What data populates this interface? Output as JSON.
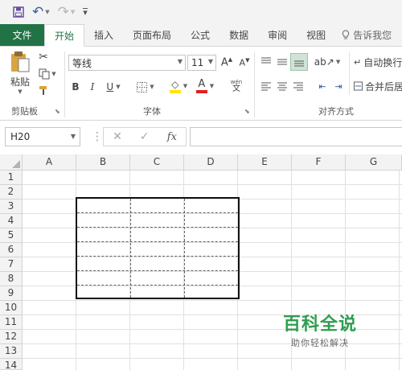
{
  "qat": {
    "save_glyph": "💾",
    "undo_glyph": "↶",
    "redo_glyph": "↷",
    "customize_glyph": "▾"
  },
  "tabs": {
    "file": "文件",
    "items": [
      "开始",
      "插入",
      "页面布局",
      "公式",
      "数据",
      "审阅",
      "视图"
    ],
    "tell_me": "告诉我您"
  },
  "ribbon": {
    "clipboard": {
      "paste": "粘贴",
      "label": "剪贴板"
    },
    "font": {
      "name": "等线",
      "size": "11",
      "bold": "B",
      "italic": "I",
      "underline": "U",
      "font_color_letter": "A",
      "label": "字体",
      "phonetic": "wén"
    },
    "alignment": {
      "wrap_text": "自动换行",
      "merge_center": "合并后居",
      "label": "对齐方式"
    }
  },
  "formula_bar": {
    "name_box": "H20",
    "cancel": "✕",
    "enter": "✓",
    "fx": "fx",
    "value": ""
  },
  "grid": {
    "columns": [
      "A",
      "B",
      "C",
      "D",
      "E",
      "F",
      "G"
    ],
    "rows": [
      "1",
      "2",
      "3",
      "4",
      "5",
      "6",
      "7",
      "8",
      "9",
      "10",
      "11",
      "12",
      "13",
      "14"
    ]
  },
  "watermark": {
    "title": "百科全说",
    "subtitle": "助你轻松解决"
  },
  "colors": {
    "excel_green": "#217346",
    "header_bg": "#f3f3f3",
    "font_color_bar": "#e02020",
    "highlight_bar": "#ffe600",
    "watermark_green": "#2e9e4f"
  }
}
